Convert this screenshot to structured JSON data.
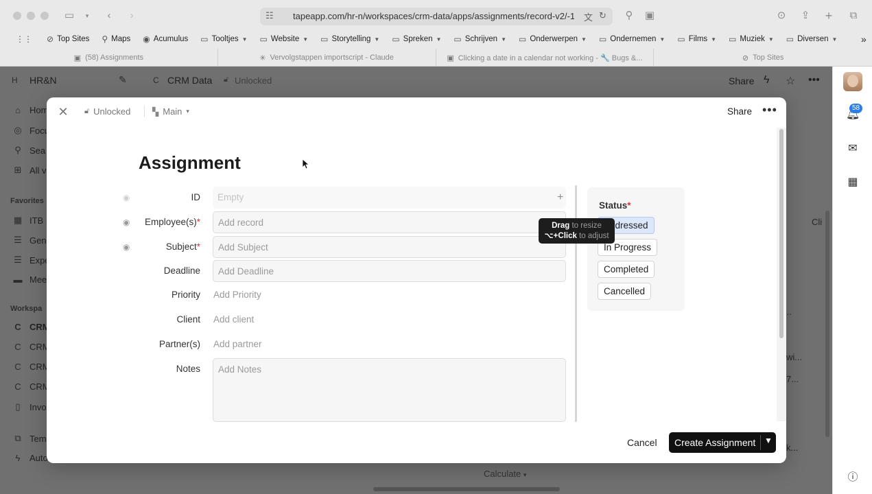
{
  "browser": {
    "url": "tapeapp.com/hr-n/workspaces/crm-data/apps/assignments/record-v2/-1",
    "bookmarks": [
      {
        "label": "Top Sites",
        "icon": "compass-icon",
        "folder": false
      },
      {
        "label": "Maps",
        "icon": "pin-icon",
        "folder": false
      },
      {
        "label": "Acumulus",
        "icon": "acumulus-icon",
        "folder": false
      },
      {
        "label": "Tooltjes",
        "icon": "folder-icon",
        "folder": true
      },
      {
        "label": "Website",
        "icon": "folder-icon",
        "folder": true
      },
      {
        "label": "Storytelling",
        "icon": "folder-icon",
        "folder": true
      },
      {
        "label": "Spreken",
        "icon": "folder-icon",
        "folder": true
      },
      {
        "label": "Schrijven",
        "icon": "folder-icon",
        "folder": true
      },
      {
        "label": "Onderwerpen",
        "icon": "folder-icon",
        "folder": true
      },
      {
        "label": "Ondernemen",
        "icon": "folder-icon",
        "folder": true
      },
      {
        "label": "Films",
        "icon": "folder-icon",
        "folder": true
      },
      {
        "label": "Muziek",
        "icon": "folder-icon",
        "folder": true
      },
      {
        "label": "Diversen",
        "icon": "folder-icon",
        "folder": true
      }
    ],
    "tabs": [
      {
        "label": "(58) Assignments",
        "icon": "tape-icon"
      },
      {
        "label": "Vervolgstappen importscript - Claude",
        "icon": "claude-icon"
      },
      {
        "label": "Clicking a date in a calendar not working - 🔧 Bugs &...",
        "icon": "tape-icon"
      },
      {
        "label": "Top Sites",
        "icon": "compass-icon"
      }
    ]
  },
  "app": {
    "workspace_badge": "H",
    "workspace_name": "HR&N",
    "crm_badge": "C",
    "crm_name": "CRM Data",
    "lock_label": "Unlocked",
    "share_label": "Share",
    "sidebar": {
      "items_top": [
        "Hom",
        "Focu",
        "Sea",
        "All v"
      ],
      "favorites_label": "Favorites",
      "favorites": [
        "ITB E",
        "Gene",
        "Expo",
        "Meet"
      ],
      "workspaces_label": "Workspa",
      "workspaces": [
        {
          "badge": "C",
          "label": "CRM"
        },
        {
          "badge": "C",
          "label": "CRM"
        },
        {
          "badge": "C",
          "label": "CRM"
        },
        {
          "badge": "C",
          "label": "CRM"
        }
      ],
      "invo": "Invo",
      "bottom": [
        "Tem",
        "Auto"
      ]
    },
    "right_fragments": [
      "Cli",
      "...",
      "wi...",
      "7...",
      "k..."
    ],
    "calculate_label": "Calculate"
  },
  "rail": {
    "notifications_count": "58"
  },
  "modal": {
    "lock_label": "Unlocked",
    "view_label": "Main",
    "share_label": "Share",
    "title": "Assignment",
    "fields": [
      {
        "label": "ID",
        "placeholder": "Empty",
        "required": false
      },
      {
        "label": "Employee(s)",
        "placeholder": "Add record",
        "required": true
      },
      {
        "label": "Subject",
        "placeholder": "Add Subject",
        "required": true
      },
      {
        "label": "Deadline",
        "placeholder": "Add Deadline",
        "required": false
      },
      {
        "label": "Priority",
        "placeholder": "Add Priority",
        "required": false
      },
      {
        "label": "Client",
        "placeholder": "Add client",
        "required": false
      },
      {
        "label": "Partner(s)",
        "placeholder": "Add partner",
        "required": false
      },
      {
        "label": "Notes",
        "placeholder": "Add Notes",
        "required": false
      }
    ],
    "status": {
      "label": "Status",
      "required_mark": "*",
      "options": [
        "Addressed",
        "In Progress",
        "Completed",
        "Cancelled"
      ],
      "selected": "Addressed"
    },
    "tooltip": {
      "line1_bold": "Drag",
      "line1_rest": " to resize",
      "line2_bold": "⌥+Click",
      "line2_rest": " to adjust"
    },
    "cancel_label": "Cancel",
    "create_label": "Create Assignment",
    "required_mark": "*"
  }
}
